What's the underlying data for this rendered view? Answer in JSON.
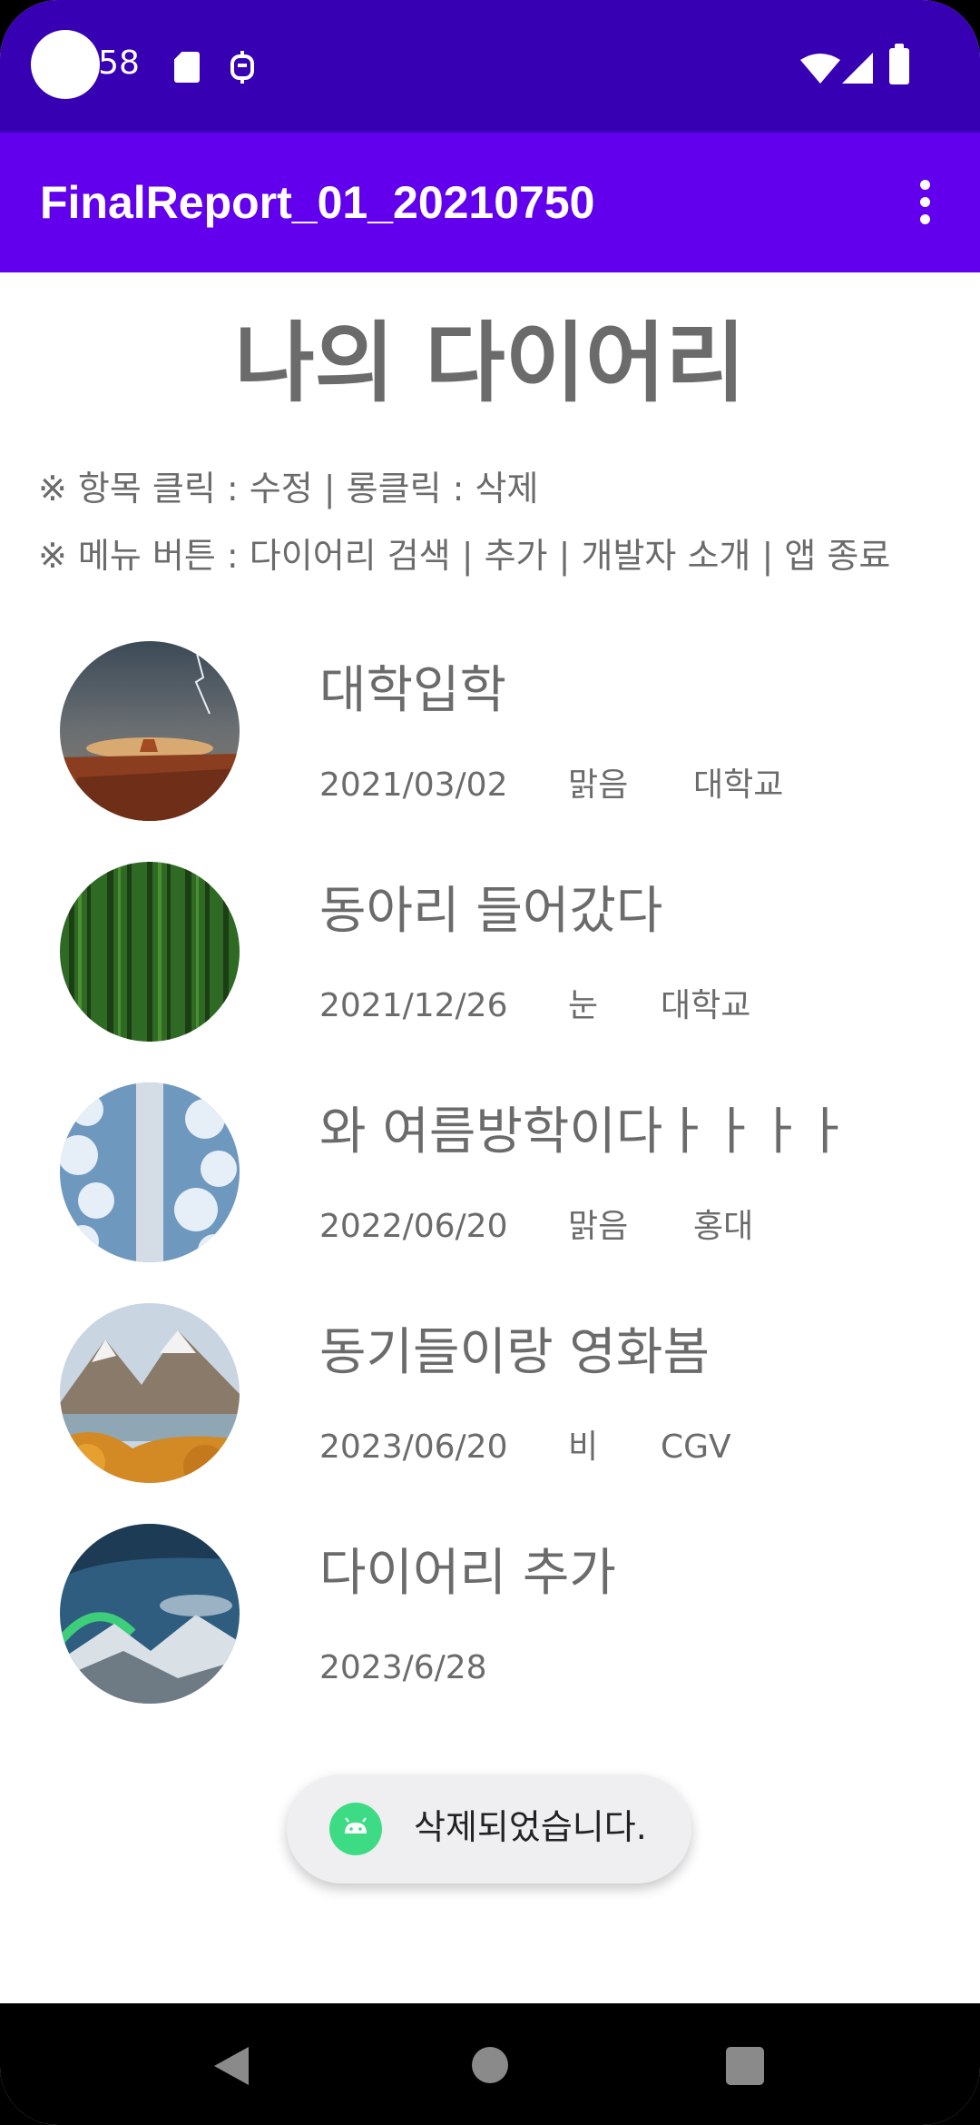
{
  "status_bar": {
    "time": ":58",
    "icons": [
      "sd-card-icon",
      "debug-icon",
      "wifi-icon",
      "signal-icon",
      "battery-icon"
    ]
  },
  "app_bar": {
    "title": "FinalReport_01_20210750",
    "menu_icon": "overflow-menu-icon"
  },
  "header": {
    "title": "나의 다이어리",
    "instruction_1": "※ 항목 클릭 : 수정  |  롱클릭 : 삭제",
    "instruction_2": "※ 메뉴 버튼  :  다이어리 검색 | 추가 | 개발자 소개 | 앱 종료"
  },
  "diary_items": [
    {
      "title": "대학입학",
      "date": "2021/03/02",
      "weather": "맑음",
      "place": "대학교",
      "thumbnail": "desert-storm-photo"
    },
    {
      "title": "동아리 들어갔다",
      "date": "2021/12/26",
      "weather": "눈",
      "place": "대학교",
      "thumbnail": "forest-photo"
    },
    {
      "title": "와 여름방학이다ㅏㅏㅏㅏ",
      "date": "2022/06/20",
      "weather": "맑음",
      "place": "홍대",
      "thumbnail": "snowy-road-photo"
    },
    {
      "title": "동기들이랑 영화봄",
      "date": "2023/06/20",
      "weather": "비",
      "place": "CGV",
      "thumbnail": "mountain-lake-photo"
    },
    {
      "title": "다이어리 추가",
      "date": "2023/6/28",
      "weather": "",
      "place": "",
      "thumbnail": "aurora-photo"
    }
  ],
  "toast": {
    "message": "삭제되었습니다.",
    "icon": "android-icon"
  },
  "nav_bar": {
    "icons": [
      "back-icon",
      "home-icon",
      "recents-icon"
    ]
  },
  "colors": {
    "status_bar": "#3700b3",
    "app_bar": "#6200ee",
    "text_gray": "#6b6b6b",
    "toast_bg": "#efeff1",
    "android_green": "#3ddc84"
  }
}
